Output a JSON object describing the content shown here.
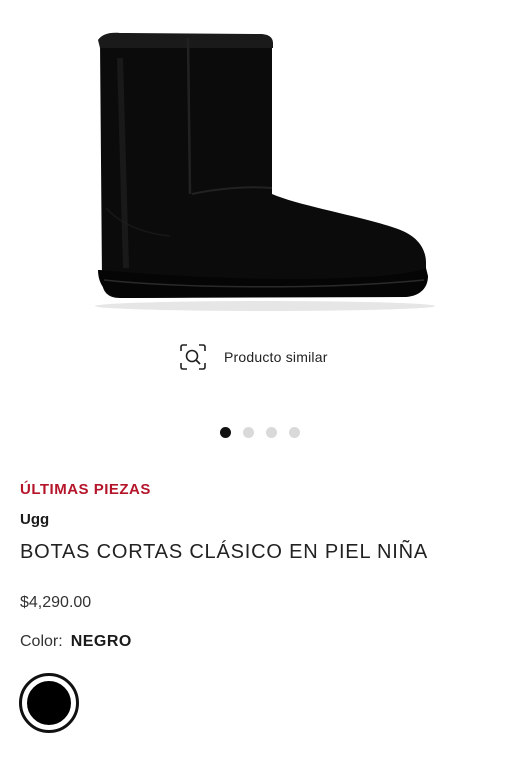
{
  "product": {
    "image_alt": "boot",
    "similar_label": "Producto similar",
    "carousel": {
      "total": 4,
      "active_index": 0
    },
    "stock_badge": "ÚLTIMAS PIEZAS",
    "brand": "Ugg",
    "title": "BOTAS CORTAS CLÁSICO EN PIEL NIÑA",
    "price": "$4,290.00",
    "color_label": "Color:",
    "color_value": "NEGRO",
    "swatch_color": "#000000"
  },
  "colors": {
    "accent_red": "#b5152b",
    "text_dark": "#1a1a1a"
  },
  "icons": {
    "similar": "visual-search-icon",
    "boot": "boot-icon"
  }
}
